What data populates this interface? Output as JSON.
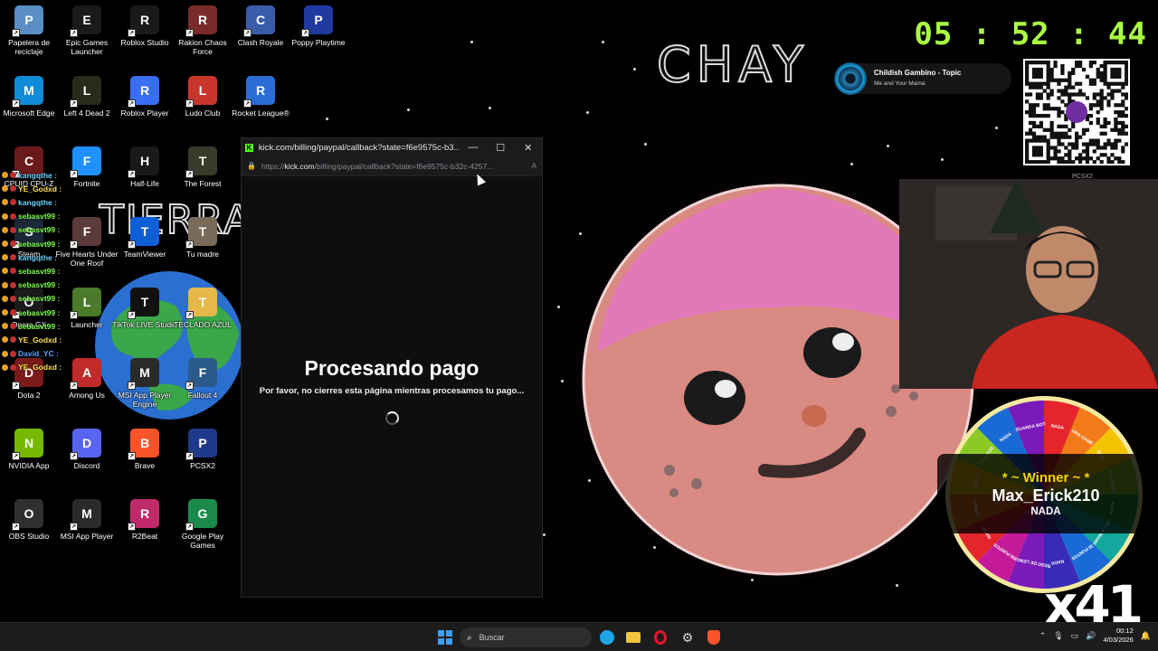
{
  "desktop_icons": [
    {
      "label": "Papelera de reciclaje",
      "icon": "recycle-bin-icon",
      "color": "#5a8ec4"
    },
    {
      "label": "Epic Games Launcher",
      "icon": "epic-games-icon",
      "color": "#1a1a1a"
    },
    {
      "label": "Roblox Studio",
      "icon": "roblox-studio-icon",
      "color": "#1a1a1a"
    },
    {
      "label": "Rakion Chaos Force",
      "icon": "rakion-icon",
      "color": "#7a2a2a"
    },
    {
      "label": "Clash Royale",
      "icon": "clash-royale-icon",
      "color": "#3a5ca8"
    },
    {
      "label": "Poppy Playtime",
      "icon": "poppy-playtime-icon",
      "color": "#1e3aa0"
    },
    {
      "label": "Microsoft Edge",
      "icon": "edge-icon",
      "color": "#0f8bd8"
    },
    {
      "label": "Left 4 Dead 2",
      "icon": "left4dead-icon",
      "color": "#2a2a1a"
    },
    {
      "label": "Roblox Player",
      "icon": "roblox-player-icon",
      "color": "#3a6ef2"
    },
    {
      "label": "Ludo Club",
      "icon": "ludo-club-icon",
      "color": "#c9342c"
    },
    {
      "label": "Rocket League®",
      "icon": "rocket-league-icon",
      "color": "#2c6cd6"
    },
    {
      "label": "CPUID CPU-Z",
      "icon": "cpuz-icon",
      "color": "#6a1a1a"
    },
    {
      "label": "Fortnite",
      "icon": "fortnite-icon",
      "color": "#1e90ff"
    },
    {
      "label": "Half-Life",
      "icon": "half-life-icon",
      "color": "#1a1a1a"
    },
    {
      "label": "The Forest",
      "icon": "the-forest-icon",
      "color": "#3a3a2a"
    },
    {
      "label": "Steam",
      "icon": "steam-icon",
      "color": "#1b2838"
    },
    {
      "label": "Five Hearts Under One Roof",
      "icon": "five-hearts-icon",
      "color": "#5a3a3a"
    },
    {
      "label": "TeamViewer",
      "icon": "teamviewer-icon",
      "color": "#0e5ed8"
    },
    {
      "label": "Tu madre",
      "icon": "tu-madre-icon",
      "color": "#7a6a5a"
    },
    {
      "label": "Opera GX",
      "icon": "opera-gx-icon",
      "color": "#1a1a1a"
    },
    {
      "label": "Launcher",
      "icon": "minecraft-launcher-icon",
      "color": "#4a7a2a"
    },
    {
      "label": "TikTok LIVE Studio",
      "icon": "tiktok-icon",
      "color": "#111"
    },
    {
      "label": "TECLADO AZUL",
      "icon": "folder-icon",
      "color": "#e6b84a"
    },
    {
      "label": "Dota 2",
      "icon": "dota2-icon",
      "color": "#7a1a1a"
    },
    {
      "label": "Among Us",
      "icon": "among-us-icon",
      "color": "#c02a2a"
    },
    {
      "label": "MSI App Player Engine",
      "icon": "msi-engine-icon",
      "color": "#2a2a2a"
    },
    {
      "label": "Fallout 4",
      "icon": "fallout4-icon",
      "color": "#2a5a8a"
    },
    {
      "label": "NVIDIA App",
      "icon": "nvidia-icon",
      "color": "#76b900"
    },
    {
      "label": "Discord",
      "icon": "discord-icon",
      "color": "#5865f2"
    },
    {
      "label": "Brave",
      "icon": "brave-icon",
      "color": "#fb542b"
    },
    {
      "label": "PCSX2",
      "icon": "pcsx2-icon",
      "color": "#1e3a8a"
    },
    {
      "label": "OBS Studio",
      "icon": "obs-icon",
      "color": "#302e31"
    },
    {
      "label": "MSI App Player",
      "icon": "msi-app-player-icon",
      "color": "#2a2a2a"
    },
    {
      "label": "R2Beat",
      "icon": "r2beat-icon",
      "color": "#c02a6a"
    },
    {
      "label": "Google Play Games",
      "icon": "google-play-games-icon",
      "color": "#1a8a4a"
    }
  ],
  "chat": [
    {
      "user": "kangqthe :",
      "color": "#69d2ff"
    },
    {
      "user": "YE_Godxd :",
      "color": "#ffe14a"
    },
    {
      "user": "kangqthe :",
      "color": "#69d2ff"
    },
    {
      "user": "sebasvt99 :",
      "color": "#7dff4a"
    },
    {
      "user": "sebasvt99 :",
      "color": "#7dff4a"
    },
    {
      "user": "sebasvt99 :",
      "color": "#7dff4a"
    },
    {
      "user": "kangqthe :",
      "color": "#69d2ff"
    },
    {
      "user": "sebasvt99 :",
      "color": "#7dff4a"
    },
    {
      "user": "sebasvt99 :",
      "color": "#7dff4a"
    },
    {
      "user": "sebasvt99 :",
      "color": "#7dff4a"
    },
    {
      "user": "sebasvt99 :",
      "color": "#7dff4a"
    },
    {
      "user": "sebasvt99 :",
      "color": "#7dff4a"
    },
    {
      "user": "YE_Godxd :",
      "color": "#ffe14a"
    },
    {
      "user": "David_YC :",
      "color": "#5aa0ff"
    },
    {
      "user": "YE_Godxd :",
      "color": "#ffe14a"
    }
  ],
  "overlay": {
    "tierra_text": "TIERRA",
    "logo_text": "CHAY",
    "clock": "05 : 52 : 44",
    "music_title": "Childish Gambino - Topic",
    "music_subtitle": "Me and Your Mama",
    "qr_label": "PCSX2",
    "winner_title": "* ~ Winner ~ *",
    "winner_name": "Max_Erick210",
    "winner_prize": "NADA",
    "multiplier": "x41",
    "wheel_segments": [
      "NADA",
      "UNA GAME",
      "NADA",
      "10 PUNTOS",
      "NADA",
      "DE LA MAMA",
      "30 PUNTOS",
      "NADA",
      "BESO DE LENGUA",
      "300 PUNTOS",
      "NADA",
      "CUMBIA",
      "NADA",
      "5 PUNTOS",
      "NADA",
      "GUARDA BOT"
    ]
  },
  "browser": {
    "title": "kick.com/billing/paypal/callback?state=f6e9575c-b3...",
    "url_prefix": "https://",
    "url_domain": "kick.com",
    "url_rest": "/billing/paypal/callback?state=f6e9575c-b32c-4257...",
    "heading": "Procesando pago",
    "message": "Por favor, no cierres esta página mientras procesamos tu pago...",
    "minimize": "—",
    "maximize": "☐",
    "close": "✕"
  },
  "taskbar": {
    "search_placeholder": "Buscar",
    "time": "00:12",
    "date": "4/03/2026",
    "colors": {
      "start": "#3aa0ff",
      "edge": "#1fa4e8",
      "explorer": "#f2c53d",
      "opera": "#e0182d",
      "brave": "#fb542b"
    }
  }
}
